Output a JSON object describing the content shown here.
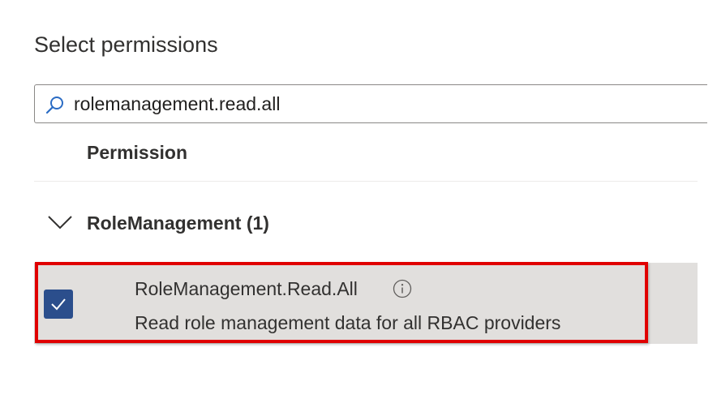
{
  "section": {
    "title": "Select permissions"
  },
  "search": {
    "value": "rolemanagement.read.all",
    "icon": "search-icon"
  },
  "table": {
    "column_header": "Permission"
  },
  "group": {
    "label": "RoleManagement (1)",
    "expanded": true
  },
  "permissions": [
    {
      "name": "RoleManagement.Read.All",
      "description": "Read role management data for all RBAC providers",
      "checked": true,
      "highlighted": true
    }
  ],
  "colors": {
    "checkbox_fill": "#2b4e8c",
    "highlight_border": "#e00000",
    "selected_row_bg": "#e1dfdd"
  }
}
